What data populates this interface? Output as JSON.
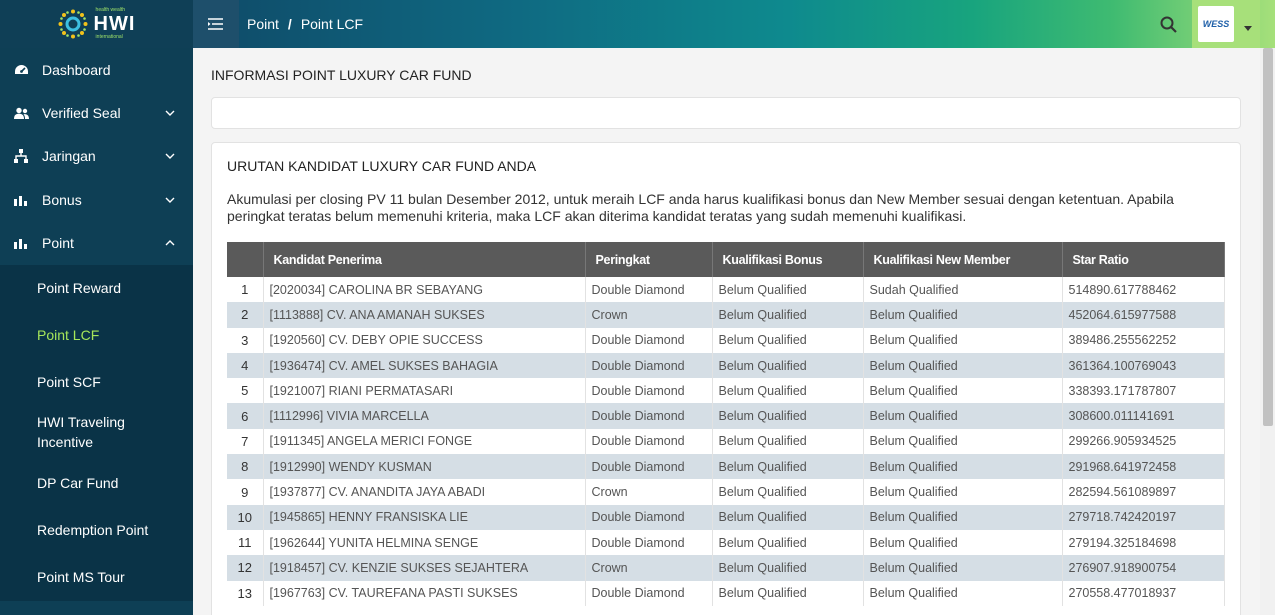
{
  "sidebar": {
    "logo_text": "HWI",
    "logo_small_top": "health wealth",
    "logo_small_bottom": "international",
    "items": [
      {
        "label": "Dashboard"
      },
      {
        "label": "Verified Seal"
      },
      {
        "label": "Jaringan"
      },
      {
        "label": "Bonus"
      },
      {
        "label": "Point"
      }
    ],
    "submenu": [
      {
        "label": "Point Reward"
      },
      {
        "label": "Point LCF"
      },
      {
        "label": "Point SCF"
      },
      {
        "label": "HWI Traveling Incentive"
      },
      {
        "label": "DP Car Fund"
      },
      {
        "label": "Redemption Point"
      },
      {
        "label": "Point MS Tour"
      }
    ],
    "active_color": "#a6e65a"
  },
  "header": {
    "breadcrumb_parent": "Point",
    "breadcrumb_sep": "/",
    "breadcrumb_current": "Point LCF",
    "avatar_text": "WESS"
  },
  "main": {
    "page_title": "INFORMASI POINT LUXURY CAR FUND",
    "card_title": "URUTAN KANDIDAT LUXURY CAR FUND ANDA",
    "description": "Akumulasi per closing PV 11 bulan Desember 2012, untuk meraih LCF anda harus kualifikasi bonus dan New Member sesuai dengan ketentuan. Apabila peringkat teratas belum memenuhi kriteria, maka LCF akan diterima kandidat teratas yang sudah memenuhi kualifikasi.",
    "table": {
      "headers": [
        "",
        "Kandidat Penerima",
        "Peringkat",
        "Kualifikasi Bonus",
        "Kualifikasi New Member",
        "Star Ratio"
      ],
      "rows": [
        [
          "1",
          "[2020034] CAROLINA BR SEBAYANG",
          "Double Diamond",
          "Belum Qualified",
          "Sudah Qualified",
          "514890.617788462"
        ],
        [
          "2",
          "[1113888] CV. ANA AMANAH SUKSES",
          "Crown",
          "Belum Qualified",
          "Belum Qualified",
          "452064.615977588"
        ],
        [
          "3",
          "[1920560] CV. DEBY OPIE SUCCESS",
          "Double Diamond",
          "Belum Qualified",
          "Belum Qualified",
          "389486.255562252"
        ],
        [
          "4",
          "[1936474] CV. AMEL SUKSES BAHAGIA",
          "Double Diamond",
          "Belum Qualified",
          "Belum Qualified",
          "361364.100769043"
        ],
        [
          "5",
          "[1921007] RIANI PERMATASARI",
          "Double Diamond",
          "Belum Qualified",
          "Belum Qualified",
          "338393.171787807"
        ],
        [
          "6",
          "[1112996] VIVIA MARCELLA",
          "Double Diamond",
          "Belum Qualified",
          "Belum Qualified",
          "308600.011141691"
        ],
        [
          "7",
          "[1911345] ANGELA MERICI FONGE",
          "Double Diamond",
          "Belum Qualified",
          "Belum Qualified",
          "299266.905934525"
        ],
        [
          "8",
          "[1912990] WENDY KUSMAN",
          "Double Diamond",
          "Belum Qualified",
          "Belum Qualified",
          "291968.641972458"
        ],
        [
          "9",
          "[1937877] CV. ANANDITA JAYA ABADI",
          "Crown",
          "Belum Qualified",
          "Belum Qualified",
          "282594.561089897"
        ],
        [
          "10",
          "[1945865] HENNY FRANSISKA LIE",
          "Double Diamond",
          "Belum Qualified",
          "Belum Qualified",
          "279718.742420197"
        ],
        [
          "11",
          "[1962644] YUNITA HELMINA SENGE",
          "Double Diamond",
          "Belum Qualified",
          "Belum Qualified",
          "279194.325184698"
        ],
        [
          "12",
          "[1918457] CV. KENZIE SUKSES SEJAHTERA",
          "Crown",
          "Belum Qualified",
          "Belum Qualified",
          "276907.918900754"
        ],
        [
          "13",
          "[1967763] CV. TAUREFANA PASTI SUKSES",
          "Double Diamond",
          "Belum Qualified",
          "Belum Qualified",
          "270558.477018937"
        ]
      ]
    }
  }
}
